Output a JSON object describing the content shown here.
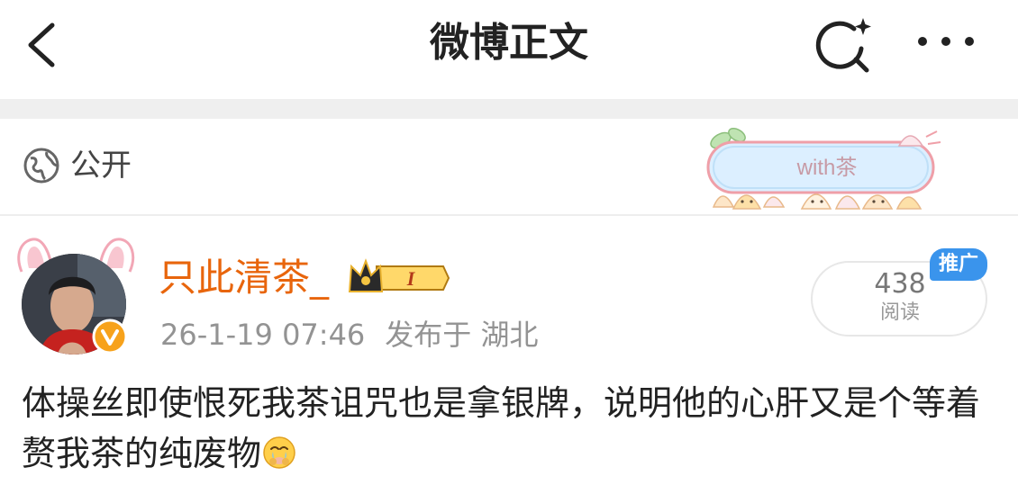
{
  "header": {
    "title": "微博正文",
    "back_icon": "back-chevron-icon",
    "search_icon": "sparkle-search-icon",
    "more_icon": "more-dots-icon"
  },
  "visibility": {
    "icon": "globe-icon",
    "label": "公开",
    "banner_text": "with茶"
  },
  "post": {
    "username": "只此清茶_",
    "badge_text": "I",
    "timestamp": "26-1-19 07:46",
    "location": "发布于 湖北",
    "reads": {
      "count": "438",
      "label": "阅读"
    },
    "promo_label": "推广",
    "content": "体操丝即使恨死我茶诅咒也是拿银牌，说明他的心肝又是个等着赘我茶的纯废物",
    "content_emoji": "crying-face-emoji"
  },
  "colors": {
    "username": "#e8650c",
    "meta": "#939393",
    "promo": "#3a94ec",
    "band": "#efefef"
  }
}
